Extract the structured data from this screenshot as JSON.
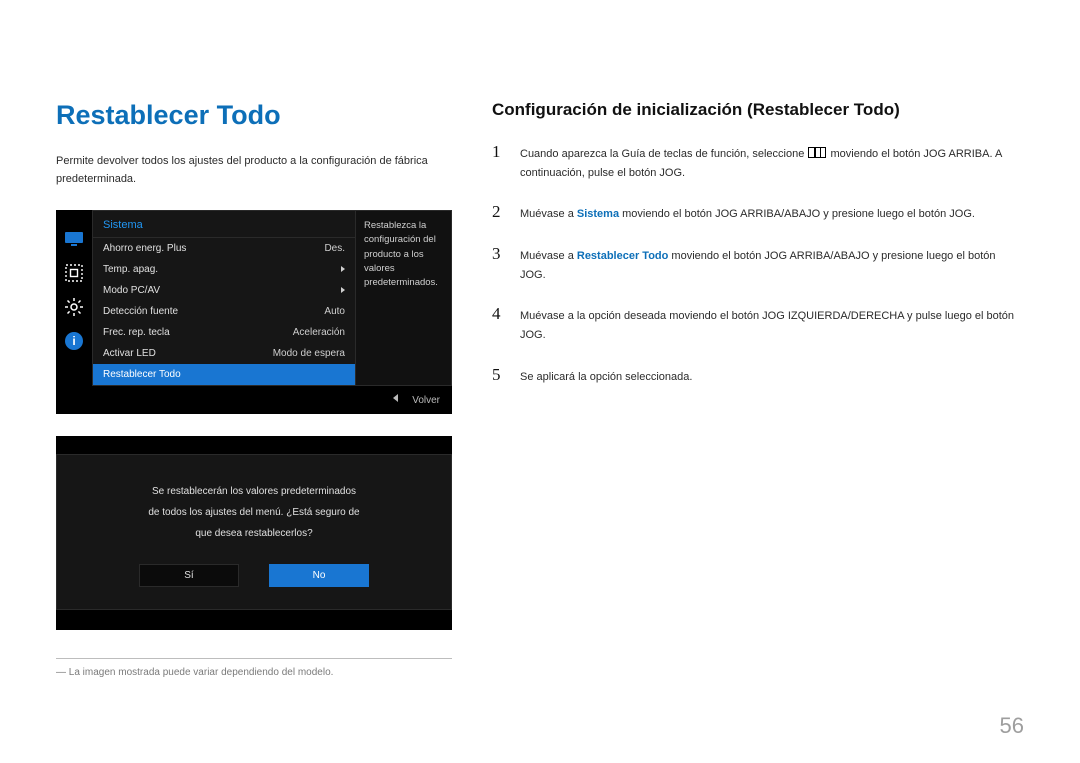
{
  "left": {
    "title": "Restablecer Todo",
    "intro": "Permite devolver todos los ajustes del producto a la configuración de fábrica predeterminada.",
    "osd": {
      "header": "Sistema",
      "desc": "Restablezca la configuración del producto a los valores predeterminados.",
      "items": [
        {
          "label": "Ahorro energ. Plus",
          "value": "Des."
        },
        {
          "label": "Temp. apag.",
          "value": "▶"
        },
        {
          "label": "Modo PC/AV",
          "value": "▶"
        },
        {
          "label": "Detección fuente",
          "value": "Auto"
        },
        {
          "label": "Frec. rep. tecla",
          "value": "Aceleración"
        },
        {
          "label": "Activar LED",
          "value": "Modo de espera"
        },
        {
          "label": "Restablecer Todo",
          "value": "",
          "selected": true
        }
      ],
      "footer": "Volver"
    },
    "confirm": {
      "line1": "Se restablecerán los valores predeterminados",
      "line2": "de todos los ajustes del menú. ¿Está seguro de",
      "line3": "que desea restablecerlos?",
      "yes": "Sí",
      "no": "No"
    },
    "footnote": "― La imagen mostrada puede variar dependiendo del modelo."
  },
  "right": {
    "subtitle": "Configuración de inicialización (Restablecer Todo)",
    "steps": {
      "s1a": "Cuando aparezca la Guía de teclas de función, seleccione ",
      "s1b": " moviendo el botón JOG ARRIBA. A continuación, pulse el botón JOG.",
      "s2a": "Muévase a ",
      "s2kw": "Sistema",
      "s2b": " moviendo el botón JOG ARRIBA/ABAJO y presione luego el botón JOG.",
      "s3a": "Muévase a ",
      "s3kw": "Restablecer Todo",
      "s3b": " moviendo el botón JOG ARRIBA/ABAJO y presione luego el botón JOG.",
      "s4": "Muévase a la opción deseada moviendo el botón JOG IZQUIERDA/DERECHA y pulse luego el botón JOG.",
      "s5": "Se aplicará la opción seleccionada."
    }
  },
  "pageNumber": "56",
  "icons": {
    "monitor": "monitor-icon",
    "picture": "picture-icon",
    "gear": "gear-icon",
    "info": "i"
  }
}
